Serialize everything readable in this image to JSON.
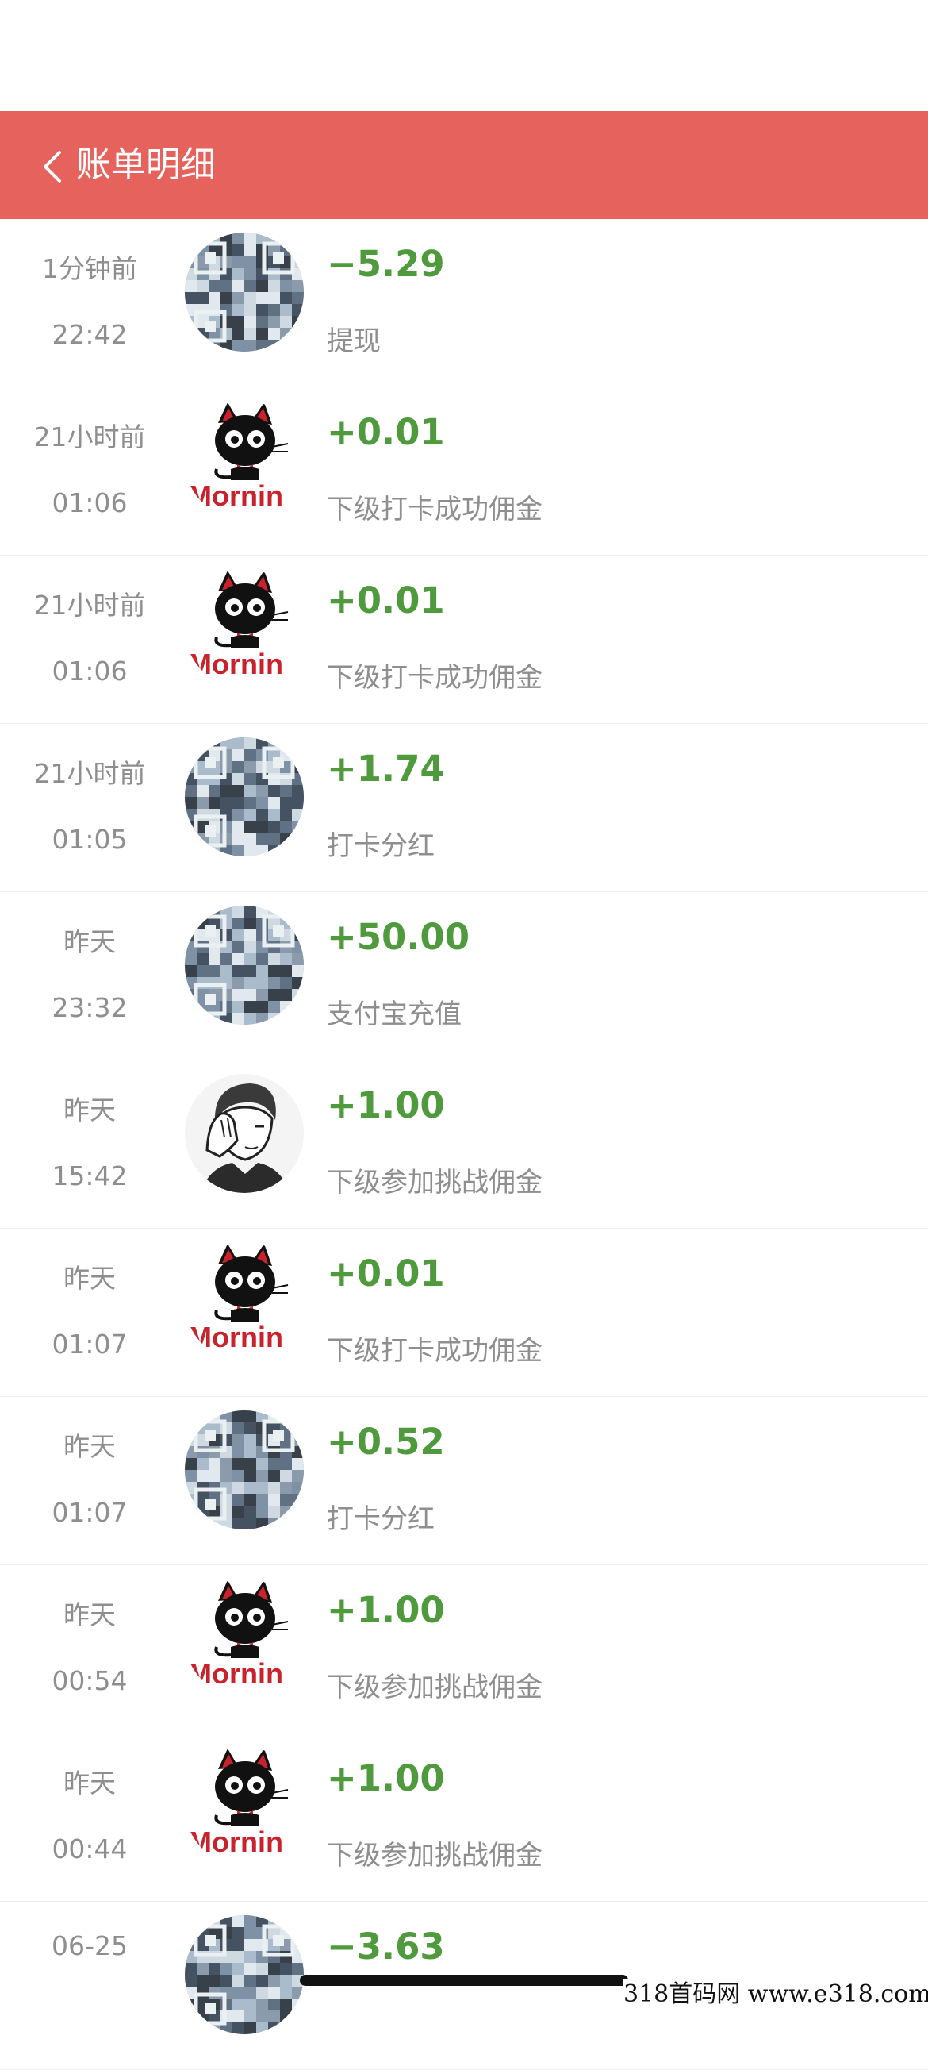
{
  "header": {
    "title": "账单明细",
    "background": "#e5625d",
    "back_icon": "chevron-left-icon"
  },
  "colors": {
    "amount": "#4f9a3d",
    "secondary_text": "#8e8e8e"
  },
  "transactions": [
    {
      "time_ago": "1分钟前",
      "time": "22:42",
      "avatar": "qr-avatar",
      "amount": "−5.29",
      "description": "提现"
    },
    {
      "time_ago": "21小时前",
      "time": "01:06",
      "avatar": "black-cat-morning-avatar",
      "amount": "+0.01",
      "description": "下级打卡成功佣金"
    },
    {
      "time_ago": "21小时前",
      "time": "01:06",
      "avatar": "black-cat-morning-avatar",
      "amount": "+0.01",
      "description": "下级打卡成功佣金"
    },
    {
      "time_ago": "21小时前",
      "time": "01:05",
      "avatar": "qr-avatar",
      "amount": "+1.74",
      "description": "打卡分红"
    },
    {
      "time_ago": "昨天",
      "time": "23:32",
      "avatar": "qr-avatar",
      "amount": "+50.00",
      "description": "支付宝充值"
    },
    {
      "time_ago": "昨天",
      "time": "15:42",
      "avatar": "sketch-man-avatar",
      "amount": "+1.00",
      "description": "下级参加挑战佣金"
    },
    {
      "time_ago": "昨天",
      "time": "01:07",
      "avatar": "black-cat-morning-avatar",
      "amount": "+0.01",
      "description": "下级打卡成功佣金"
    },
    {
      "time_ago": "昨天",
      "time": "01:07",
      "avatar": "qr-avatar",
      "amount": "+0.52",
      "description": "打卡分红"
    },
    {
      "time_ago": "昨天",
      "time": "00:54",
      "avatar": "black-cat-morning-avatar",
      "amount": "+1.00",
      "description": "下级参加挑战佣金"
    },
    {
      "time_ago": "昨天",
      "time": "00:44",
      "avatar": "black-cat-morning-avatar",
      "amount": "+1.00",
      "description": "下级参加挑战佣金"
    },
    {
      "time_ago": "06-25",
      "time": "",
      "avatar": "qr-avatar",
      "amount": "−3.63",
      "description": ""
    }
  ],
  "watermark": {
    "text": "318首码网  www.e318.com"
  }
}
